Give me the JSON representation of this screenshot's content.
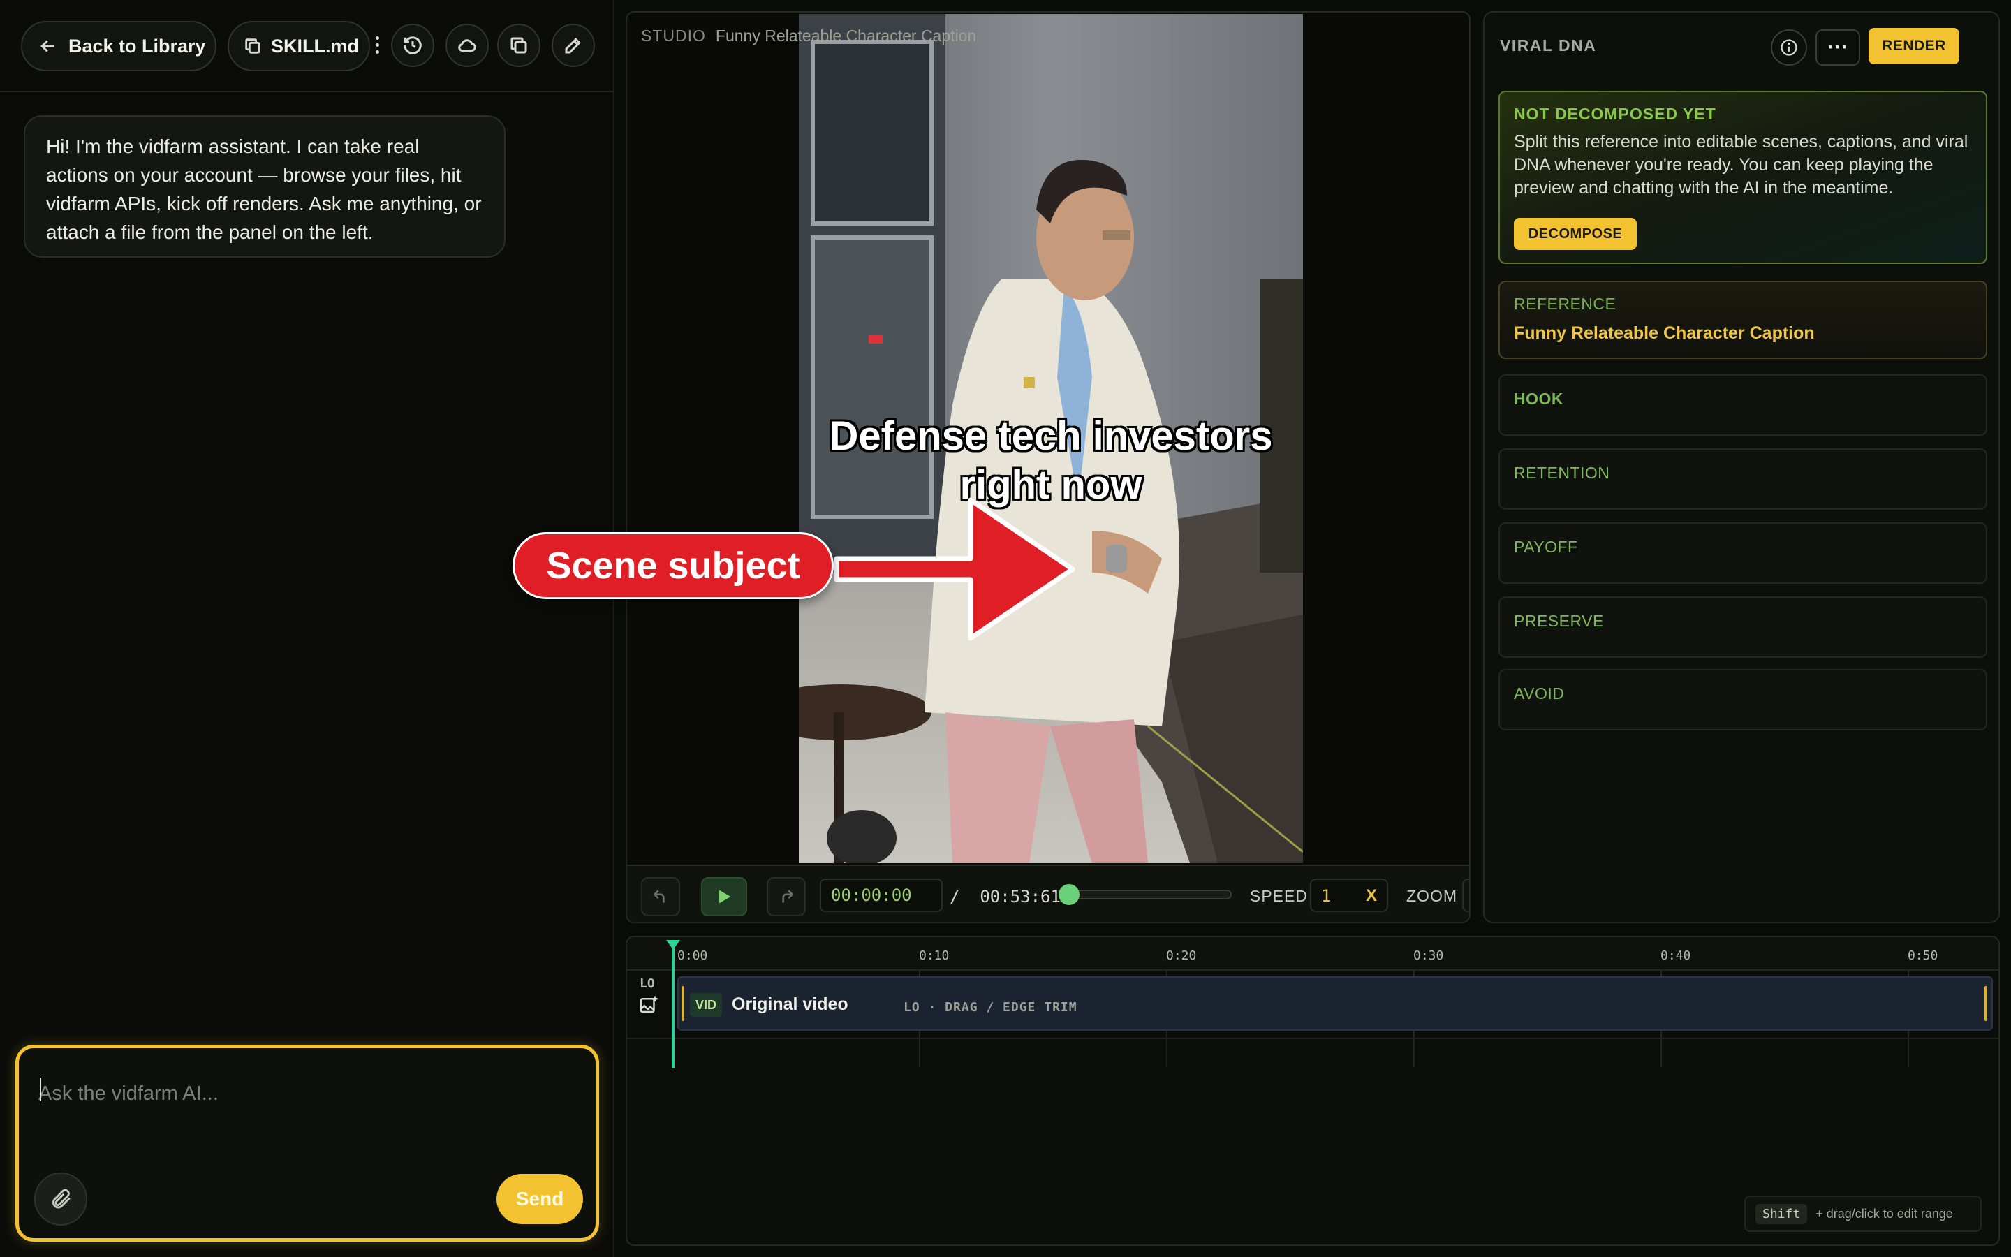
{
  "chat": {
    "back_label": "Back to Library",
    "skill_file": "SKILL.md",
    "assistant_message": "Hi! I'm the vidfarm assistant. I can take real actions on your account — browse your files, hit vidfarm APIs, kick off renders. Ask me anything, or attach a file from the panel on the left.",
    "composer_placeholder": "Ask the vidfarm AI...",
    "send_label": "Send"
  },
  "studio": {
    "label": "STUDIO",
    "title": "Funny Relateable Character Caption",
    "caption_line1": "Defense tech investors",
    "caption_line2": "right now",
    "callout": "Scene subject",
    "time_current": "00:00:00",
    "time_separator": "/",
    "time_total": "00:53:61",
    "progress": 0,
    "speed_label": "SPEED",
    "speed_value": "1",
    "speed_unit": "X",
    "zoom_label": "ZOOM"
  },
  "dna": {
    "title": "VIRAL DNA",
    "render_label": "RENDER",
    "not_decomposed": {
      "title": "NOT DECOMPOSED YET",
      "body": "Split this reference into editable scenes, captions, and viral DNA whenever you're ready. You can keep playing the preview and chatting with the AI in the meantime.",
      "button": "DECOMPOSE"
    },
    "reference": {
      "label": "REFERENCE",
      "title": "Funny Relateable Character Caption"
    },
    "sections": [
      "HOOK",
      "RETENTION",
      "PAYOFF",
      "PRESERVE",
      "AVOID"
    ]
  },
  "timeline": {
    "ticks": [
      "0:00",
      "0:10",
      "0:20",
      "0:30",
      "0:40",
      "0:50"
    ],
    "track_label": "LO",
    "clip_badge": "VID",
    "clip_name": "Original video",
    "clip_hint": "LO · DRAG / EDGE TRIM",
    "shift_key": "Shift",
    "shift_hint": "+ drag/click to edit range"
  },
  "colors": {
    "accent_yellow": "#f2c230",
    "accent_green": "#7fb859",
    "playhead": "#2fd097",
    "callout_red": "#e01e25"
  }
}
